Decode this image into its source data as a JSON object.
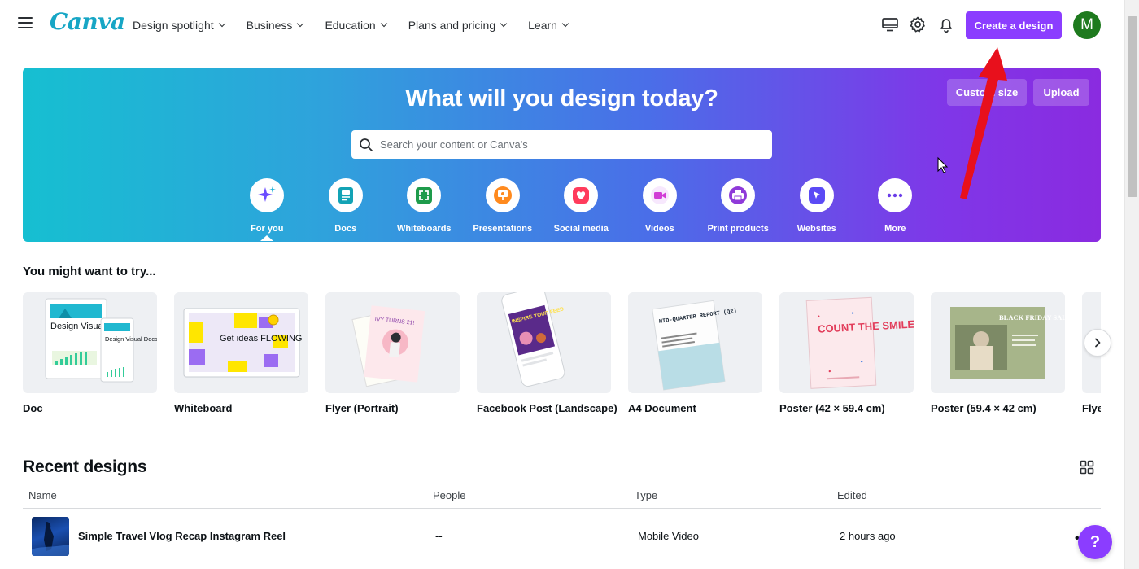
{
  "header": {
    "logo": "Canva",
    "nav": [
      {
        "label": "Design spotlight"
      },
      {
        "label": "Business"
      },
      {
        "label": "Education"
      },
      {
        "label": "Plans and pricing"
      },
      {
        "label": "Learn"
      }
    ],
    "create_button": "Create a design",
    "avatar_initial": "M",
    "icons": [
      "menu-icon",
      "monitor-icon",
      "gear-icon",
      "bell-icon"
    ]
  },
  "hero": {
    "title": "What will you design today?",
    "customize_button": "Custom size",
    "upload_button": "Upload",
    "search": {
      "placeholder": "Search your content or Canva's",
      "value": ""
    },
    "categories": [
      {
        "label": "For you",
        "icon": "sparkle-icon",
        "selected": true
      },
      {
        "label": "Docs",
        "icon": "doc-icon"
      },
      {
        "label": "Whiteboards",
        "icon": "whiteboard-icon"
      },
      {
        "label": "Presentations",
        "icon": "presentation-icon"
      },
      {
        "label": "Social media",
        "icon": "heart-icon"
      },
      {
        "label": "Videos",
        "icon": "video-icon"
      },
      {
        "label": "Print products",
        "icon": "printer-icon"
      },
      {
        "label": "Websites",
        "icon": "cursor-icon"
      },
      {
        "label": "More",
        "icon": "more-icon"
      }
    ]
  },
  "try_section": {
    "title": "You might want to try...",
    "items": [
      {
        "label": "Doc"
      },
      {
        "label": "Whiteboard"
      },
      {
        "label": "Flyer (Portrait)"
      },
      {
        "label": "Facebook Post (Landscape)"
      },
      {
        "label": "A4 Document"
      },
      {
        "label": "Poster (42 × 59.4 cm)"
      },
      {
        "label": "Poster (59.4 × 42 cm)"
      },
      {
        "label": "Flyer"
      }
    ],
    "thumb_text": {
      "doc_main": "Design Visual Docs",
      "doc_small": "Design Visual Docs",
      "whiteboard": "Get ideas FLOWING",
      "flyer": "IVY TURNS 21!",
      "facebook": "INSPIRE YOUR FEED",
      "a4": "MID-QUARTER REPORT (Q2)",
      "poster_portrait": "COUNT THE SMILES",
      "poster_landscape": "BLACK FRIDAY SALE!"
    }
  },
  "recent": {
    "title": "Recent designs",
    "columns": {
      "name": "Name",
      "people": "People",
      "type": "Type",
      "edited": "Edited"
    },
    "rows": [
      {
        "name": "Simple Travel Vlog Recap Instagram Reel",
        "people": "--",
        "type": "Mobile Video",
        "edited": "2 hours ago"
      }
    ]
  },
  "help_label": "?",
  "colors": {
    "primary": "#8b3dff",
    "logo": "#17a6c5",
    "annotation_arrow": "#e8101c"
  }
}
